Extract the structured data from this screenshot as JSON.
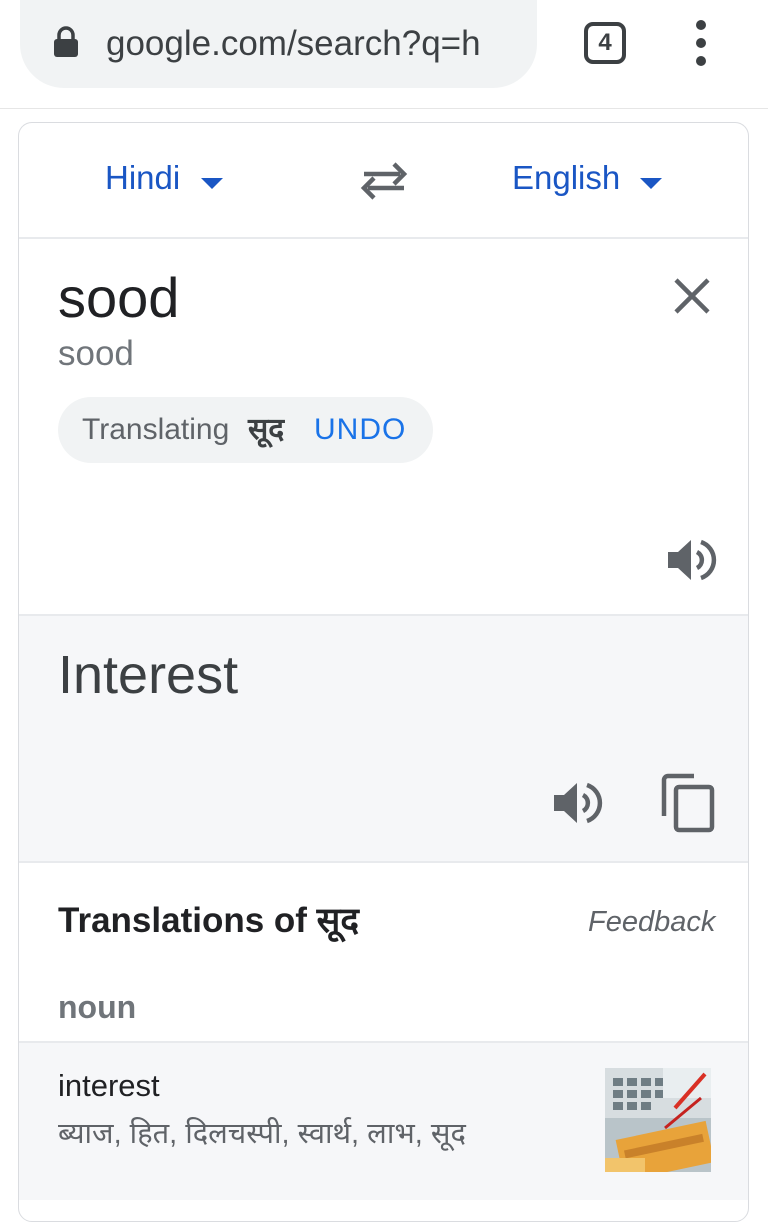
{
  "browser": {
    "url_text": "google.com/search?q=h",
    "tab_count": "4",
    "lock_icon": "lock-icon",
    "menu_icon": "more-vert-icon"
  },
  "translate": {
    "source_language": "Hindi",
    "target_language": "English",
    "source_text": "sood",
    "source_transliteration": "sood",
    "translating_label": "Translating",
    "translating_word": "सूद",
    "undo_label": "UNDO",
    "translation": "Interest",
    "translations_heading": "Translations of",
    "translations_heading_word": "सूद",
    "feedback_label": "Feedback",
    "part_of_speech": "noun",
    "entries": [
      {
        "word": "interest",
        "synonyms": "ब्याज, हित, दिलचस्पी, स्वार्थ, लाभ, सूद"
      }
    ]
  },
  "colors": {
    "accent_blue": "#1a56c4",
    "link_blue": "#1a73e8",
    "panel_gray": "#f6f7f9"
  }
}
